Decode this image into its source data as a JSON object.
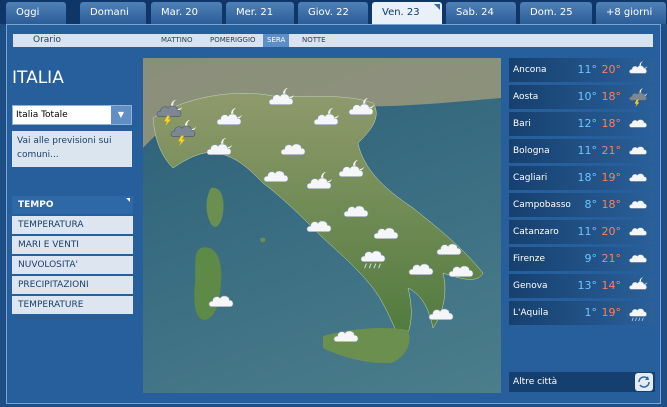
{
  "tabs": [
    "Oggi",
    "Domani",
    "Mar. 20",
    "Mer. 21",
    "Giov. 22",
    "Ven. 23",
    "Sab. 24",
    "Dom. 25",
    "+8 giorni"
  ],
  "active_tab": "Ven. 23",
  "time_slots": {
    "label": "Orario",
    "items": [
      "MATTINO",
      "POMERIGGIO",
      "SERA",
      "NOTTE"
    ],
    "active": "SERA"
  },
  "region": {
    "title": "ITALIA",
    "select_value": "Italia Totale",
    "forecast_link": "Vai alle previsioni sui comuni..."
  },
  "categories": {
    "items": [
      "TEMPO",
      "TEMPERATURA",
      "MARI E VENTI",
      "NUVOLOSITA'",
      "PRECIPITAZIONI",
      "TEMPERATURE"
    ],
    "active": "TEMPO"
  },
  "cities": [
    {
      "name": "Ancona",
      "min": "11°",
      "max": "20°",
      "icon": "moon-cloud-icon"
    },
    {
      "name": "Aosta",
      "min": "10°",
      "max": "18°",
      "icon": "storm-cloud-icon"
    },
    {
      "name": "Bari",
      "min": "12°",
      "max": "18°",
      "icon": "cloud-icon"
    },
    {
      "name": "Bologna",
      "min": "11°",
      "max": "21°",
      "icon": "cloud-icon"
    },
    {
      "name": "Cagliari",
      "min": "18°",
      "max": "19°",
      "icon": "cloud-icon"
    },
    {
      "name": "Campobasso",
      "min": "8°",
      "max": "18°",
      "icon": "cloud-icon"
    },
    {
      "name": "Catanzaro",
      "min": "11°",
      "max": "20°",
      "icon": "cloud-icon"
    },
    {
      "name": "Firenze",
      "min": "9°",
      "max": "21°",
      "icon": "cloud-icon"
    },
    {
      "name": "Genova",
      "min": "13°",
      "max": "14°",
      "icon": "moon-cloud-icon"
    },
    {
      "name": "L'Aquila",
      "min": "1°",
      "max": "19°",
      "icon": "rain-cloud-icon"
    }
  ],
  "other_cities": "Altre città",
  "colors": {
    "accent": "#2f68a6",
    "min_temp": "#6ec6ff",
    "max_temp": "#ff7f5f"
  }
}
